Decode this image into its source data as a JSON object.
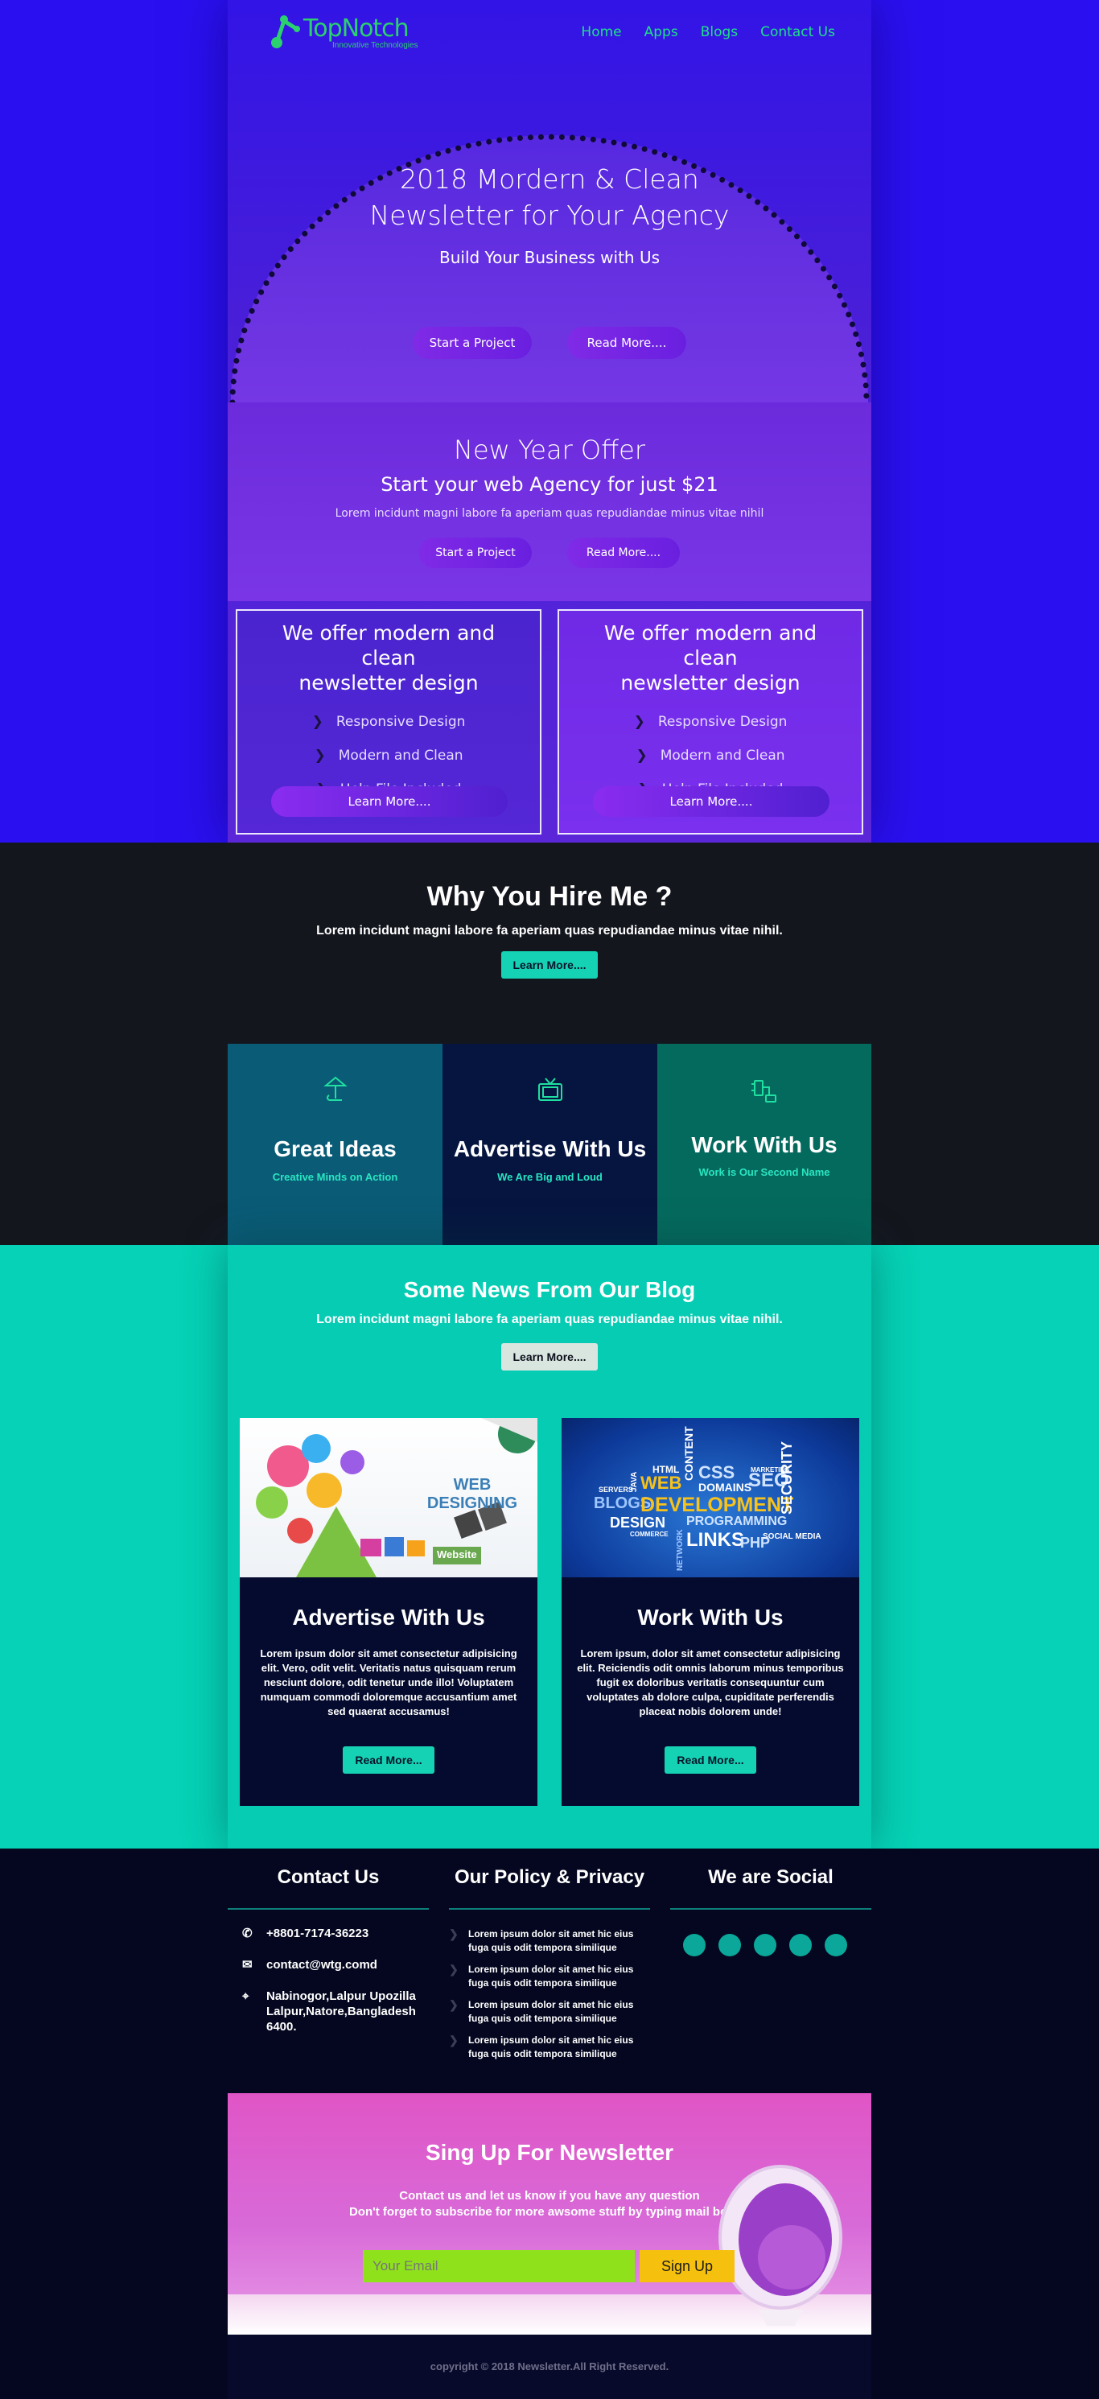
{
  "brand": {
    "name": "TopNotch",
    "tagline": "Innovative Technologies",
    "color": "#2bd16e"
  },
  "nav": {
    "items": [
      "Home",
      "Apps",
      "Blogs",
      "Contact Us"
    ]
  },
  "hero": {
    "title_line1": "2018 Mordern & Clean",
    "title_line2": "Newsletter for Your Agency",
    "subtitle": "Build Your Business with Us",
    "primary_button": "Start a Project",
    "secondary_button": "Read More...."
  },
  "offer": {
    "title": "New Year Offer",
    "subtitle": "Start your web Agency for just $21",
    "text": "Lorem incidunt magni labore fa aperiam quas repudiandae minus vitae nihil",
    "primary_button": "Start a Project",
    "secondary_button": "Read More...."
  },
  "feature_cards": [
    {
      "title_line1": "We offer modern and clean",
      "title_line2": "newsletter design",
      "items": [
        "Responsive Design",
        "Modern and Clean",
        "Help File Included"
      ],
      "button": "Learn More...."
    },
    {
      "title_line1": "We offer modern and clean",
      "title_line2": "newsletter design",
      "items": [
        "Responsive Design",
        "Modern and Clean",
        "Help File Included"
      ],
      "button": "Learn More...."
    }
  ],
  "hire": {
    "title": "Why You Hire Me ?",
    "text": "Lorem incidunt magni labore fa aperiam quas repudiandae minus vitae nihil.",
    "button": "Learn More...."
  },
  "tiles": [
    {
      "icon": "lamp-icon",
      "title": "Great Ideas",
      "tagline": "Creative Minds on Action"
    },
    {
      "icon": "tv-icon",
      "title": "Advertise With Us",
      "tagline": "We Are Big and Loud"
    },
    {
      "icon": "plug-icon",
      "title": "Work With Us",
      "tagline": "Work is Our Second Name"
    }
  ],
  "blog": {
    "title": "Some News From Our Blog",
    "text": "Lorem incidunt magni labore fa aperiam quas repudiandae minus vitae nihil.",
    "button": "Learn More....",
    "posts": [
      {
        "image_label": "WEB DESIGNING",
        "image_badge": "Website",
        "title": "Advertise With Us",
        "text": "Lorem ipsum dolor sit amet consectetur adipisicing elit. Vero, odit velit. Veritatis natus quisquam rerum nesciunt dolore, odit tenetur unde illo! Voluptatem numquam commodi doloremque accusantium amet sed quaerat accusamus!",
        "button": "Read More..."
      },
      {
        "image_words": [
          "HTML",
          "CSS",
          "WEB",
          "DOMAINS",
          "SEO",
          "BLOGS",
          "DEVELOPMENT",
          "DESIGN",
          "PROGRAMMING",
          "LINKS",
          "PHP",
          "SECURITY",
          "SOCIAL MEDIA",
          "CONTENT",
          "JAVA",
          "SERVERS",
          "MARKETING",
          "NETWORK",
          "COMMERCE"
        ],
        "title": "Work With Us",
        "text": "Lorem ipsum, dolor sit amet consectetur adipisicing elit. Reiciendis odit omnis laborum minus temporibus fugit ex doloribus veritatis consequuntur cum voluptates ab dolore culpa, cupiditate perferendis placeat nobis dolorem unde!",
        "button": "Read More..."
      }
    ]
  },
  "footer": {
    "contact": {
      "title": "Contact Us",
      "phone": "+8801-7174-36223",
      "email": "contact@wtg.comd",
      "address": "Nabinogor,Lalpur Upozilla Lalpur,Natore,Bangladesh 6400."
    },
    "policy": {
      "title": "Our Policy & Privacy",
      "items": [
        "Lorem ipsum dolor sit amet hic eius fuga quis odit tempora similique",
        "Lorem ipsum dolor sit amet hic eius fuga quis odit tempora similique",
        "Lorem ipsum dolor sit amet hic eius fuga quis odit tempora similique",
        "Lorem ipsum dolor sit amet hic eius fuga quis odit tempora similique"
      ]
    },
    "social": {
      "title": "We are Social",
      "icons": [
        "facebook-icon",
        "twitter-icon",
        "dribbble-icon",
        "instagram-icon",
        "dribbble-alt-icon"
      ]
    }
  },
  "newsletter": {
    "title": "Sing Up For Newsletter",
    "line1": "Contact us and let us know if you have any question",
    "line2": "Don't forget to subscribe for more awsome stuff by typing mail below.",
    "placeholder": "Your Email",
    "button": "Sign Up"
  },
  "copyright": "copyright © 2018 Newsletter.All Right Reserved.",
  "colors": {
    "primary_blue": "#2a10f0",
    "purple": "#7a30ee",
    "mint": "#16d2b4",
    "navy": "#050b2e",
    "yellow": "#f6c10e",
    "lime": "#8fe21b"
  }
}
